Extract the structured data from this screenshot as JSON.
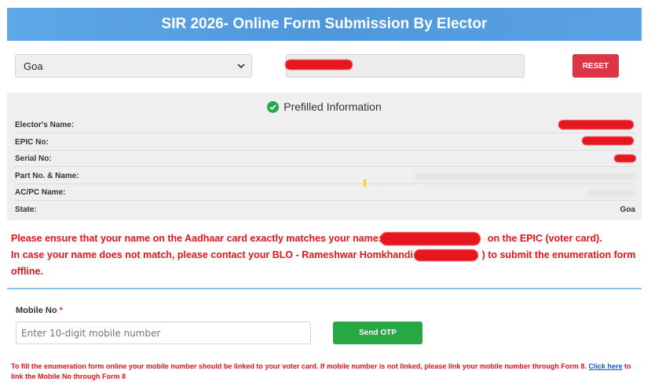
{
  "header": {
    "title": "SIR 2026- Online Form Submission By Elector"
  },
  "search": {
    "state_value": "Goa",
    "reset_label": "RESET"
  },
  "prefilled": {
    "title": "Prefilled Information",
    "rows": [
      {
        "label": "Elector's Name:",
        "value": ""
      },
      {
        "label": "EPIC No:",
        "value": ""
      },
      {
        "label": "Serial No:",
        "value": ""
      },
      {
        "label": "Part No. & Name:",
        "value": ""
      },
      {
        "label": "AC/PC Name:",
        "value": ""
      },
      {
        "label": "State:",
        "value": "Goa"
      }
    ]
  },
  "warning": {
    "line1_prefix": "Please ensure that your name on the Aadhaar card exactly matches your name:",
    "line1_suffix": "on the EPIC (voter card).",
    "line2_prefix": "In case your name does not match, please contact your BLO - Rameshwar Homkhandi (",
    "line2_suffix": ") to submit the enumeration form",
    "line3": "offline."
  },
  "mobile": {
    "label": "Mobile No",
    "required_mark": "*",
    "placeholder": "Enter 10-digit mobile number",
    "send_otp_label": "Send OTP"
  },
  "footnote": {
    "text": "To fill the enumeration form online your mobile number should be linked to your voter card. If mobile number is not linked, please link your mobile number through Form 8.",
    "link_label": "Click here",
    "suffix": "to link the Mobile No through Form 8"
  },
  "colors": {
    "header": "#4f97dc",
    "reset": "#dc3545",
    "send_otp": "#28a745",
    "warning": "#e4131b",
    "check": "#28a745"
  }
}
